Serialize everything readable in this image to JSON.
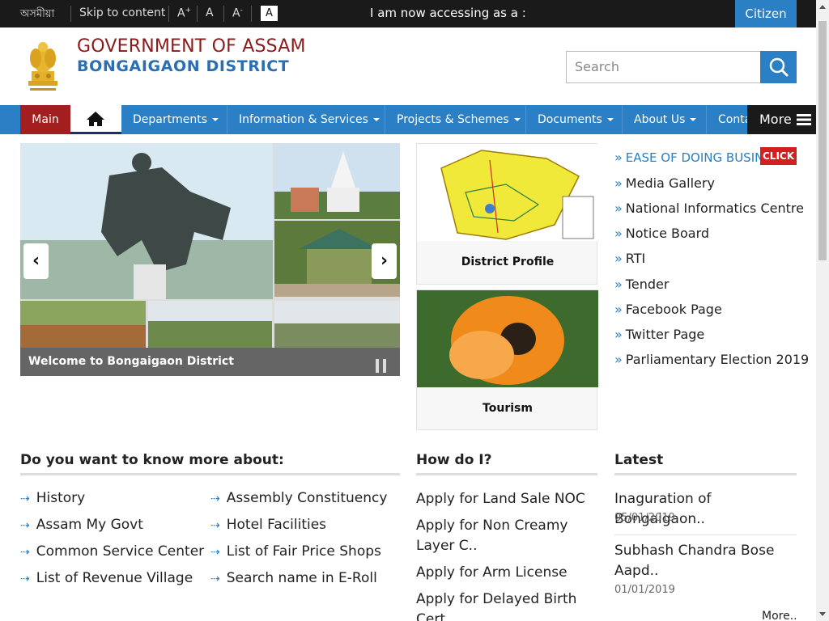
{
  "topbar": {
    "lang": "অসমীয়া",
    "skip": "Skip to content",
    "font_inc": "A+",
    "font_norm": "A",
    "font_dec": "A-",
    "contrast": "A",
    "accessing": "I am now accessing as a :",
    "role": "Citizen"
  },
  "header": {
    "gov": "GOVERNMENT OF ASSAM",
    "district": "BONGAIGAON DISTRICT",
    "search_placeholder": "Search"
  },
  "nav": {
    "main": "Main",
    "items": [
      "Departments",
      "Information & Services",
      "Projects & Schemes",
      "Documents",
      "About Us",
      "Conta"
    ],
    "more": "More"
  },
  "slider": {
    "caption": "Welcome to Bongaigaon District"
  },
  "cards": {
    "profile": "District Profile",
    "tourism": "Tourism"
  },
  "quick_links": {
    "ease": "EASE OF DOING BUSINE",
    "click": "CLICK",
    "items": [
      "Media Gallery",
      "National Informatics Centre",
      "Notice Board",
      "RTI",
      "Tender",
      "Facebook Page",
      "Twitter Page",
      "Parliamentary Election 2019"
    ]
  },
  "know": {
    "title": "Do you want to know more about:",
    "col1": [
      "History",
      "Assam My Govt",
      "Common Service Center",
      "List of Revenue Village"
    ],
    "col2": [
      "Assembly Constituency",
      "Hotel Facilities",
      "List of Fair Price Shops",
      "Search name in E-Roll"
    ]
  },
  "howdo": {
    "title": "How do I?",
    "items": [
      "Apply for Land Sale NOC",
      "Apply for Non Creamy Layer C..",
      "Apply for Arm License",
      "Apply for Delayed Birth Cert.."
    ]
  },
  "latest": {
    "title": "Latest",
    "items": [
      {
        "title": "Inaguration of Bongaigaon..",
        "date": "05/01/2019"
      },
      {
        "title": "Subhash Chandra Bose Aapd..",
        "date": "01/01/2019"
      }
    ],
    "more": "More.."
  }
}
